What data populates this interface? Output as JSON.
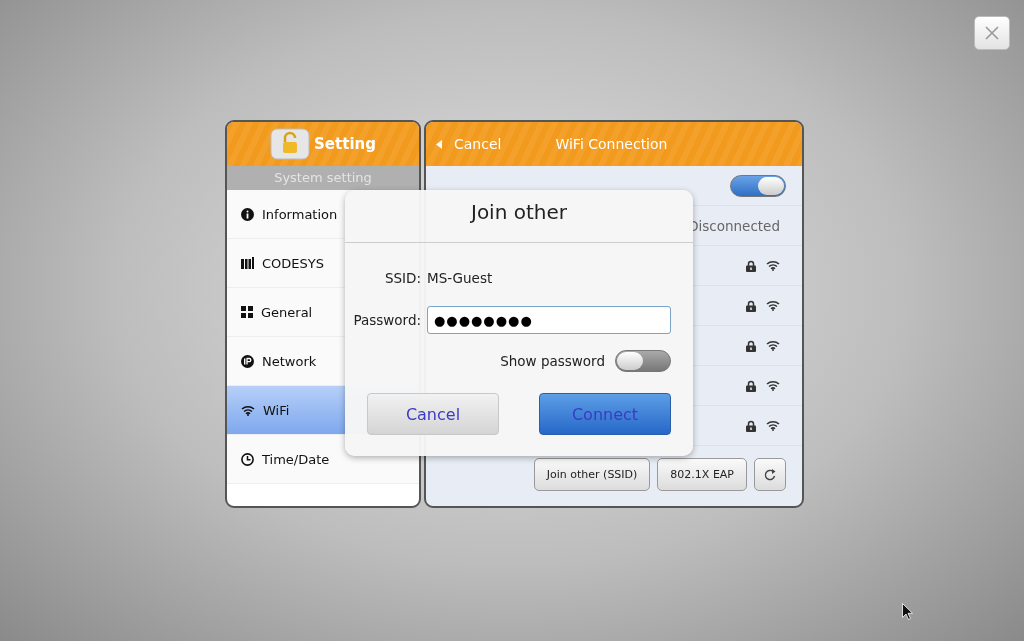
{
  "sidebar": {
    "title": "Setting",
    "subtitle": "System setting",
    "items": [
      {
        "label": "Information",
        "kind": "info",
        "selected": false
      },
      {
        "label": "CODESYS",
        "kind": "codesys",
        "selected": false
      },
      {
        "label": "General",
        "kind": "general",
        "selected": false
      },
      {
        "label": "Network",
        "kind": "ip",
        "selected": false
      },
      {
        "label": "WiFi",
        "kind": "wifi",
        "selected": true
      },
      {
        "label": "Time/Date",
        "kind": "clock",
        "selected": false
      }
    ]
  },
  "wifi_panel": {
    "back": "Cancel",
    "title": "WiFi Connection",
    "radio_on": true,
    "status": "Disconnected",
    "networks": [
      {
        "secured": true
      },
      {
        "secured": true
      },
      {
        "secured": true
      },
      {
        "secured": true
      },
      {
        "secured": true
      }
    ],
    "buttons": [
      "Join other (SSID)",
      "802.1X EAP"
    ]
  },
  "dialog": {
    "title": "Join other",
    "ssid_label": "SSID:",
    "ssid": "MS-Guest",
    "password_label": "Password:",
    "password": "●●●●●●●●",
    "show_password_label": "Show password",
    "show_password": false,
    "buttons": [
      {
        "label": "Cancel",
        "kind": "secondary"
      },
      {
        "label": "Connect",
        "kind": "primary"
      }
    ]
  }
}
